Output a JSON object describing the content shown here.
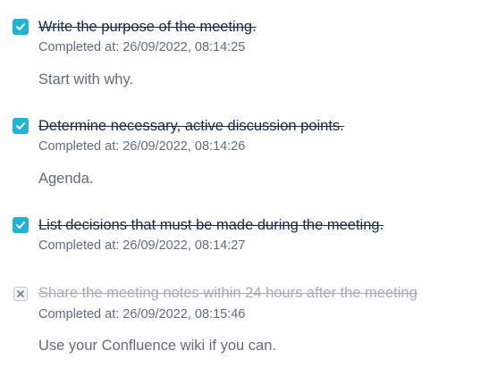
{
  "tasks": [
    {
      "title": "Write the purpose of the meeting.",
      "completed_at": "Completed at: 26/09/2022, 08:14:25",
      "note": "Start with why.",
      "state": "checked",
      "icon": "checkbox-checked-icon"
    },
    {
      "title": "Determine necessary, active discussion points.",
      "completed_at": "Completed at: 26/09/2022, 08:14:26",
      "note": "Agenda.",
      "state": "checked",
      "icon": "checkbox-checked-icon"
    },
    {
      "title": "List decisions that must be made during the meeting.",
      "completed_at": "Completed at: 26/09/2022, 08:14:27",
      "note": "",
      "state": "checked",
      "icon": "checkbox-checked-icon"
    },
    {
      "title": "Share the meeting notes within 24 hours after the meeting",
      "completed_at": "Completed at: 26/09/2022, 08:15:46",
      "note": "Use your Confluence wiki if you can.",
      "state": "cancelled",
      "icon": "checkbox-cancelled-icon"
    }
  ],
  "colors": {
    "checkbox_checked": "#1fb5d1",
    "title_text": "#172b4d",
    "cancelled_text": "#a5adba",
    "secondary_text": "#5e6c84"
  }
}
